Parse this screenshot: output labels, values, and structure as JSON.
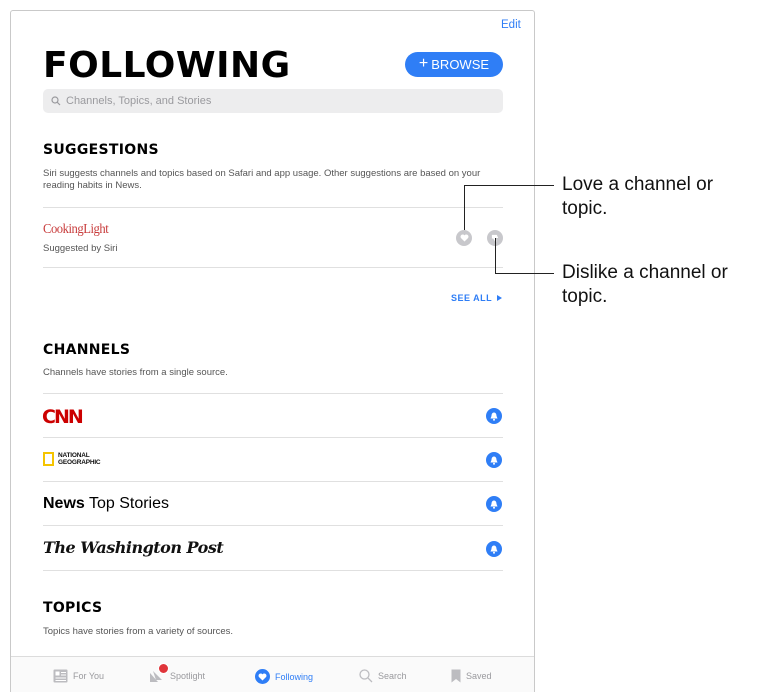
{
  "header": {
    "edit_label": "Edit",
    "title": "FOLLOWING",
    "browse_label": "BROWSE",
    "search_placeholder": "Channels, Topics, and Stories"
  },
  "suggestions": {
    "heading": "SUGGESTIONS",
    "description": "Siri suggests channels and topics based on Safari and app usage. Other suggestions are based on your reading habits in News.",
    "item": {
      "name": "CookingLight",
      "subtitle": "Suggested by Siri"
    },
    "see_all_label": "SEE ALL"
  },
  "channels": {
    "heading": "CHANNELS",
    "description": "Channels have stories from a single source.",
    "items": [
      {
        "name": "CNN"
      },
      {
        "name": "NATIONAL GEOGRAPHIC",
        "line1": "NATIONAL",
        "line2": "GEOGRAPHIC"
      },
      {
        "name": "News Top Stories",
        "bold": "News",
        "rest": " Top Stories"
      },
      {
        "name": "The Washington Post"
      }
    ]
  },
  "topics": {
    "heading": "TOPICS",
    "description": "Topics have stories from a variety of sources."
  },
  "tabbar": {
    "tabs": [
      {
        "label": "For You",
        "icon": "newspaper-icon"
      },
      {
        "label": "Spotlight",
        "icon": "spotlight-icon"
      },
      {
        "label": "Following",
        "icon": "heart-icon",
        "active": true
      },
      {
        "label": "Search",
        "icon": "magnifier-icon"
      },
      {
        "label": "Saved",
        "icon": "bookmark-icon"
      }
    ]
  },
  "callouts": {
    "love": "Love a channel or topic.",
    "love_line1": "Love a channel or",
    "love_line2": "topic.",
    "dislike_line1": "Dislike a channel or",
    "dislike_line2": "topic."
  },
  "colors": {
    "accent": "#2f7ef6",
    "cnn_red": "#cc0000",
    "cooking_light": "#c83b3b",
    "natgeo_yellow": "#f5c400",
    "badge_red": "#e0353b"
  }
}
